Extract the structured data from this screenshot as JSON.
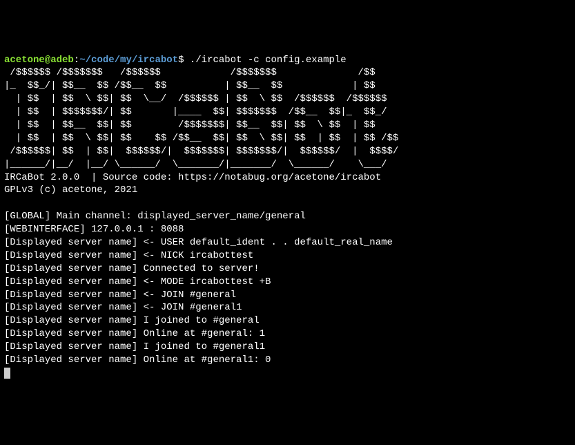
{
  "prompt": {
    "user_host": "acetone@adeb",
    "colon": ":",
    "path": "~/code/my/ircabot",
    "dollar": "$",
    "command": " ./ircabot -c config.example"
  },
  "ascii_art": [
    " /$$$$$$ /$$$$$$$   /$$$$$$            /$$$$$$$              /$$  ",
    "|_  $$_/| $$__  $$ /$$__  $$          | $$__  $$            | $$  ",
    "  | $$  | $$  \\ $$| $$  \\__/  /$$$$$$ | $$  \\ $$  /$$$$$$  /$$$$$$",
    "  | $$  | $$$$$$$/| $$       |____  $$| $$$$$$$  /$$__  $$|_  $$_/",
    "  | $$  | $$__  $$| $$        /$$$$$$$| $$__  $$| $$  \\ $$  | $$  ",
    "  | $$  | $$  \\ $$| $$    $$ /$$__  $$| $$  \\ $$| $$  | $$  | $$ /$$",
    " /$$$$$$| $$  | $$|  $$$$$$/|  $$$$$$$| $$$$$$$/|  $$$$$$/  |  $$$$/",
    "|______/|__/  |__/ \\______/  \\_______/|_______/  \\______/    \\___/ "
  ],
  "info": {
    "version": "IRCaBot 2.0.0  | Source code: https://notabug.org/acetone/ircabot",
    "license": "GPLv3 (c) acetone, 2021"
  },
  "log_lines": [
    "[GLOBAL] Main channel: displayed_server_name/general",
    "[WEBINTERFACE] 127.0.0.1 : 8088",
    "[Displayed server name] <- USER default_ident . . default_real_name",
    "[Displayed server name] <- NICK ircabottest",
    "[Displayed server name] Connected to server!",
    "[Displayed server name] <- MODE ircabottest +B",
    "[Displayed server name] <- JOIN #general",
    "[Displayed server name] <- JOIN #general1",
    "[Displayed server name] I joined to #general",
    "[Displayed server name] Online at #general: 1",
    "[Displayed server name] I joined to #general1",
    "[Displayed server name] Online at #general1: 0"
  ]
}
